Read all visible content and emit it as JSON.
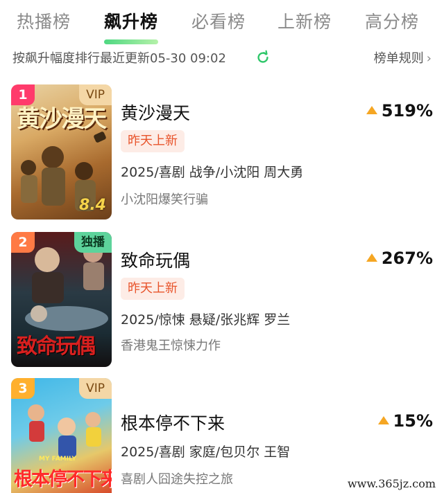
{
  "tabs": [
    {
      "label": "热播榜",
      "active": false
    },
    {
      "label": "飙升榜",
      "active": true
    },
    {
      "label": "必看榜",
      "active": false
    },
    {
      "label": "上新榜",
      "active": false
    },
    {
      "label": "高分榜",
      "active": false
    }
  ],
  "subbar": {
    "sort_desc": "按飙升幅度排行最近更新05-30 09:02",
    "refresh_icon": "refresh-icon",
    "rules_label": "榜单规则",
    "rules_chevron": "›"
  },
  "items": [
    {
      "rank": "1",
      "rank_color": "#ff3b6b",
      "badge": "VIP",
      "badge_type": "vip",
      "poster_title": "黄沙漫天",
      "score": "8.4",
      "title": "黄沙漫天",
      "trend": "519%",
      "tag": "昨天上新",
      "meta": "2025/喜剧 战争/小沈阳 周大勇",
      "desc": "小沈阳爆笑行骗"
    },
    {
      "rank": "2",
      "rank_color": "#ff7a45",
      "badge": "独播",
      "badge_type": "exclusive",
      "poster_title": "致命玩偶",
      "score": "",
      "title": "致命玩偶",
      "trend": "267%",
      "tag": "昨天上新",
      "meta": "2025/惊悚 悬疑/张兆辉 罗兰",
      "desc": "香港鬼王惊悚力作"
    },
    {
      "rank": "3",
      "rank_color": "#ffb02e",
      "badge": "VIP",
      "badge_type": "vip",
      "poster_title": "根本停不下来",
      "poster_caption": "MY FAMILY",
      "score": "",
      "title": "根本停不下来",
      "trend": "15%",
      "tag": "",
      "meta": "2025/喜剧 家庭/包贝尔 王智",
      "desc": "喜剧人囧途失控之旅"
    }
  ],
  "watermark": "www.365jz.com",
  "colors": {
    "accent_green": "#2fd16b",
    "trend_arrow": "#f5a623",
    "new_tag_bg": "#fdece6",
    "new_tag_text": "#e8542b"
  }
}
